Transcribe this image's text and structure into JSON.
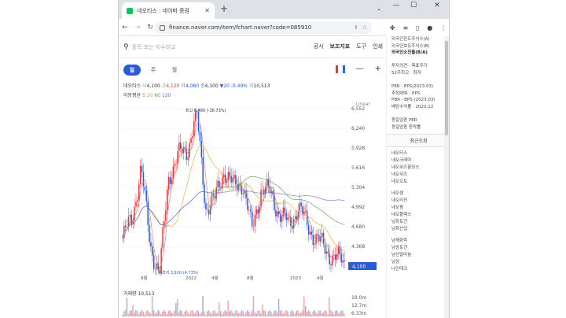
{
  "browser": {
    "tab_title": "네오티스 : 네이버 증권",
    "new_tab": "+",
    "url": "finance.naver.com/item/fchart.naver?code=085910",
    "controls": {
      "minimize": "—",
      "maximize": "☐",
      "close": "✕"
    }
  },
  "search": {
    "placeholder": "종목 또는 지수비교",
    "menu": [
      "공시",
      "보조지표",
      "도구",
      "인쇄"
    ]
  },
  "periods": [
    "일",
    "주",
    "월"
  ],
  "ohlc": {
    "name": "네오티스",
    "open_label": "시",
    "open": "4,100",
    "high_label": "고",
    "high": "4,120",
    "low_label": "저",
    "low": "4,080",
    "close_label": "종",
    "close": "4,100",
    "change": "▼20 -0.49%",
    "volume_label": "거",
    "volume": "10,513"
  },
  "ma": {
    "label": "이동평균",
    "p5": "5",
    "p20": "20",
    "p60": "60",
    "p120": "120"
  },
  "scale_label": "Linear",
  "y_ticks": [
    "6,552",
    "6,240",
    "5,928",
    "5,616",
    "5,304",
    "4,992",
    "4,680",
    "4,368"
  ],
  "current_price": "4,100",
  "high_annotation": "최고 6,480 (-36.73%)",
  "low_annotation": "최저 3,910 (4.73%)",
  "volume_title": "거래량 10,513",
  "volume_ticks": [
    "19.0m",
    "12.7m",
    "6.33m"
  ],
  "x_ticks": [
    "8월",
    "2022",
    "4월",
    "8월",
    "2023",
    "4월"
  ],
  "chart_data": {
    "type": "line",
    "title": "네오티스",
    "ylim": [
      3910,
      6552
    ],
    "y_ticks": [
      6552,
      6240,
      5928,
      5616,
      5304,
      4992,
      4680,
      4368
    ],
    "x": [
      "8월",
      "2022",
      "4월",
      "8월",
      "2023",
      "4월"
    ],
    "series": [
      {
        "name": "5",
        "values": [
          4500,
          4800,
          5600,
          4400,
          3910,
          5500,
          5800,
          5900,
          6480,
          5000,
          5100,
          5600,
          5300,
          5400,
          4600,
          5300,
          5200,
          4900,
          4700,
          5000,
          4700,
          4500,
          4300,
          4200,
          4100
        ]
      }
    ],
    "last": 4100,
    "high": 6480,
    "low": 3910,
    "volume_ylim": [
      0,
      19.0
    ]
  },
  "right_panel": {
    "info": [
      "외국인한도주식수(A)",
      "외국인보유주식수(B)",
      "외국인소진율(B/A)",
      "",
      "투자의견 · 목표주가",
      "52주최고 · 최저",
      "",
      "PER · EPS(2023.03)",
      "추정PER · EPS",
      "PBR · BPS (2023.03)",
      "배당수익률 · 2022.12",
      "",
      "동일업종 PER",
      "동일업종 등락률"
    ],
    "recent_title": "최근조회",
    "recent": [
      "네오티스",
      "네오크레마",
      "네오위즈홀딩스",
      "네오위즈",
      "네오오토",
      "",
      "네오셈",
      "네오리진",
      "네오팜",
      "네오플렉스",
      "남화토건",
      "남화산업",
      "",
      "남해화학",
      "남광토건",
      "남선알미늄",
      "남성",
      "나인테크"
    ]
  }
}
